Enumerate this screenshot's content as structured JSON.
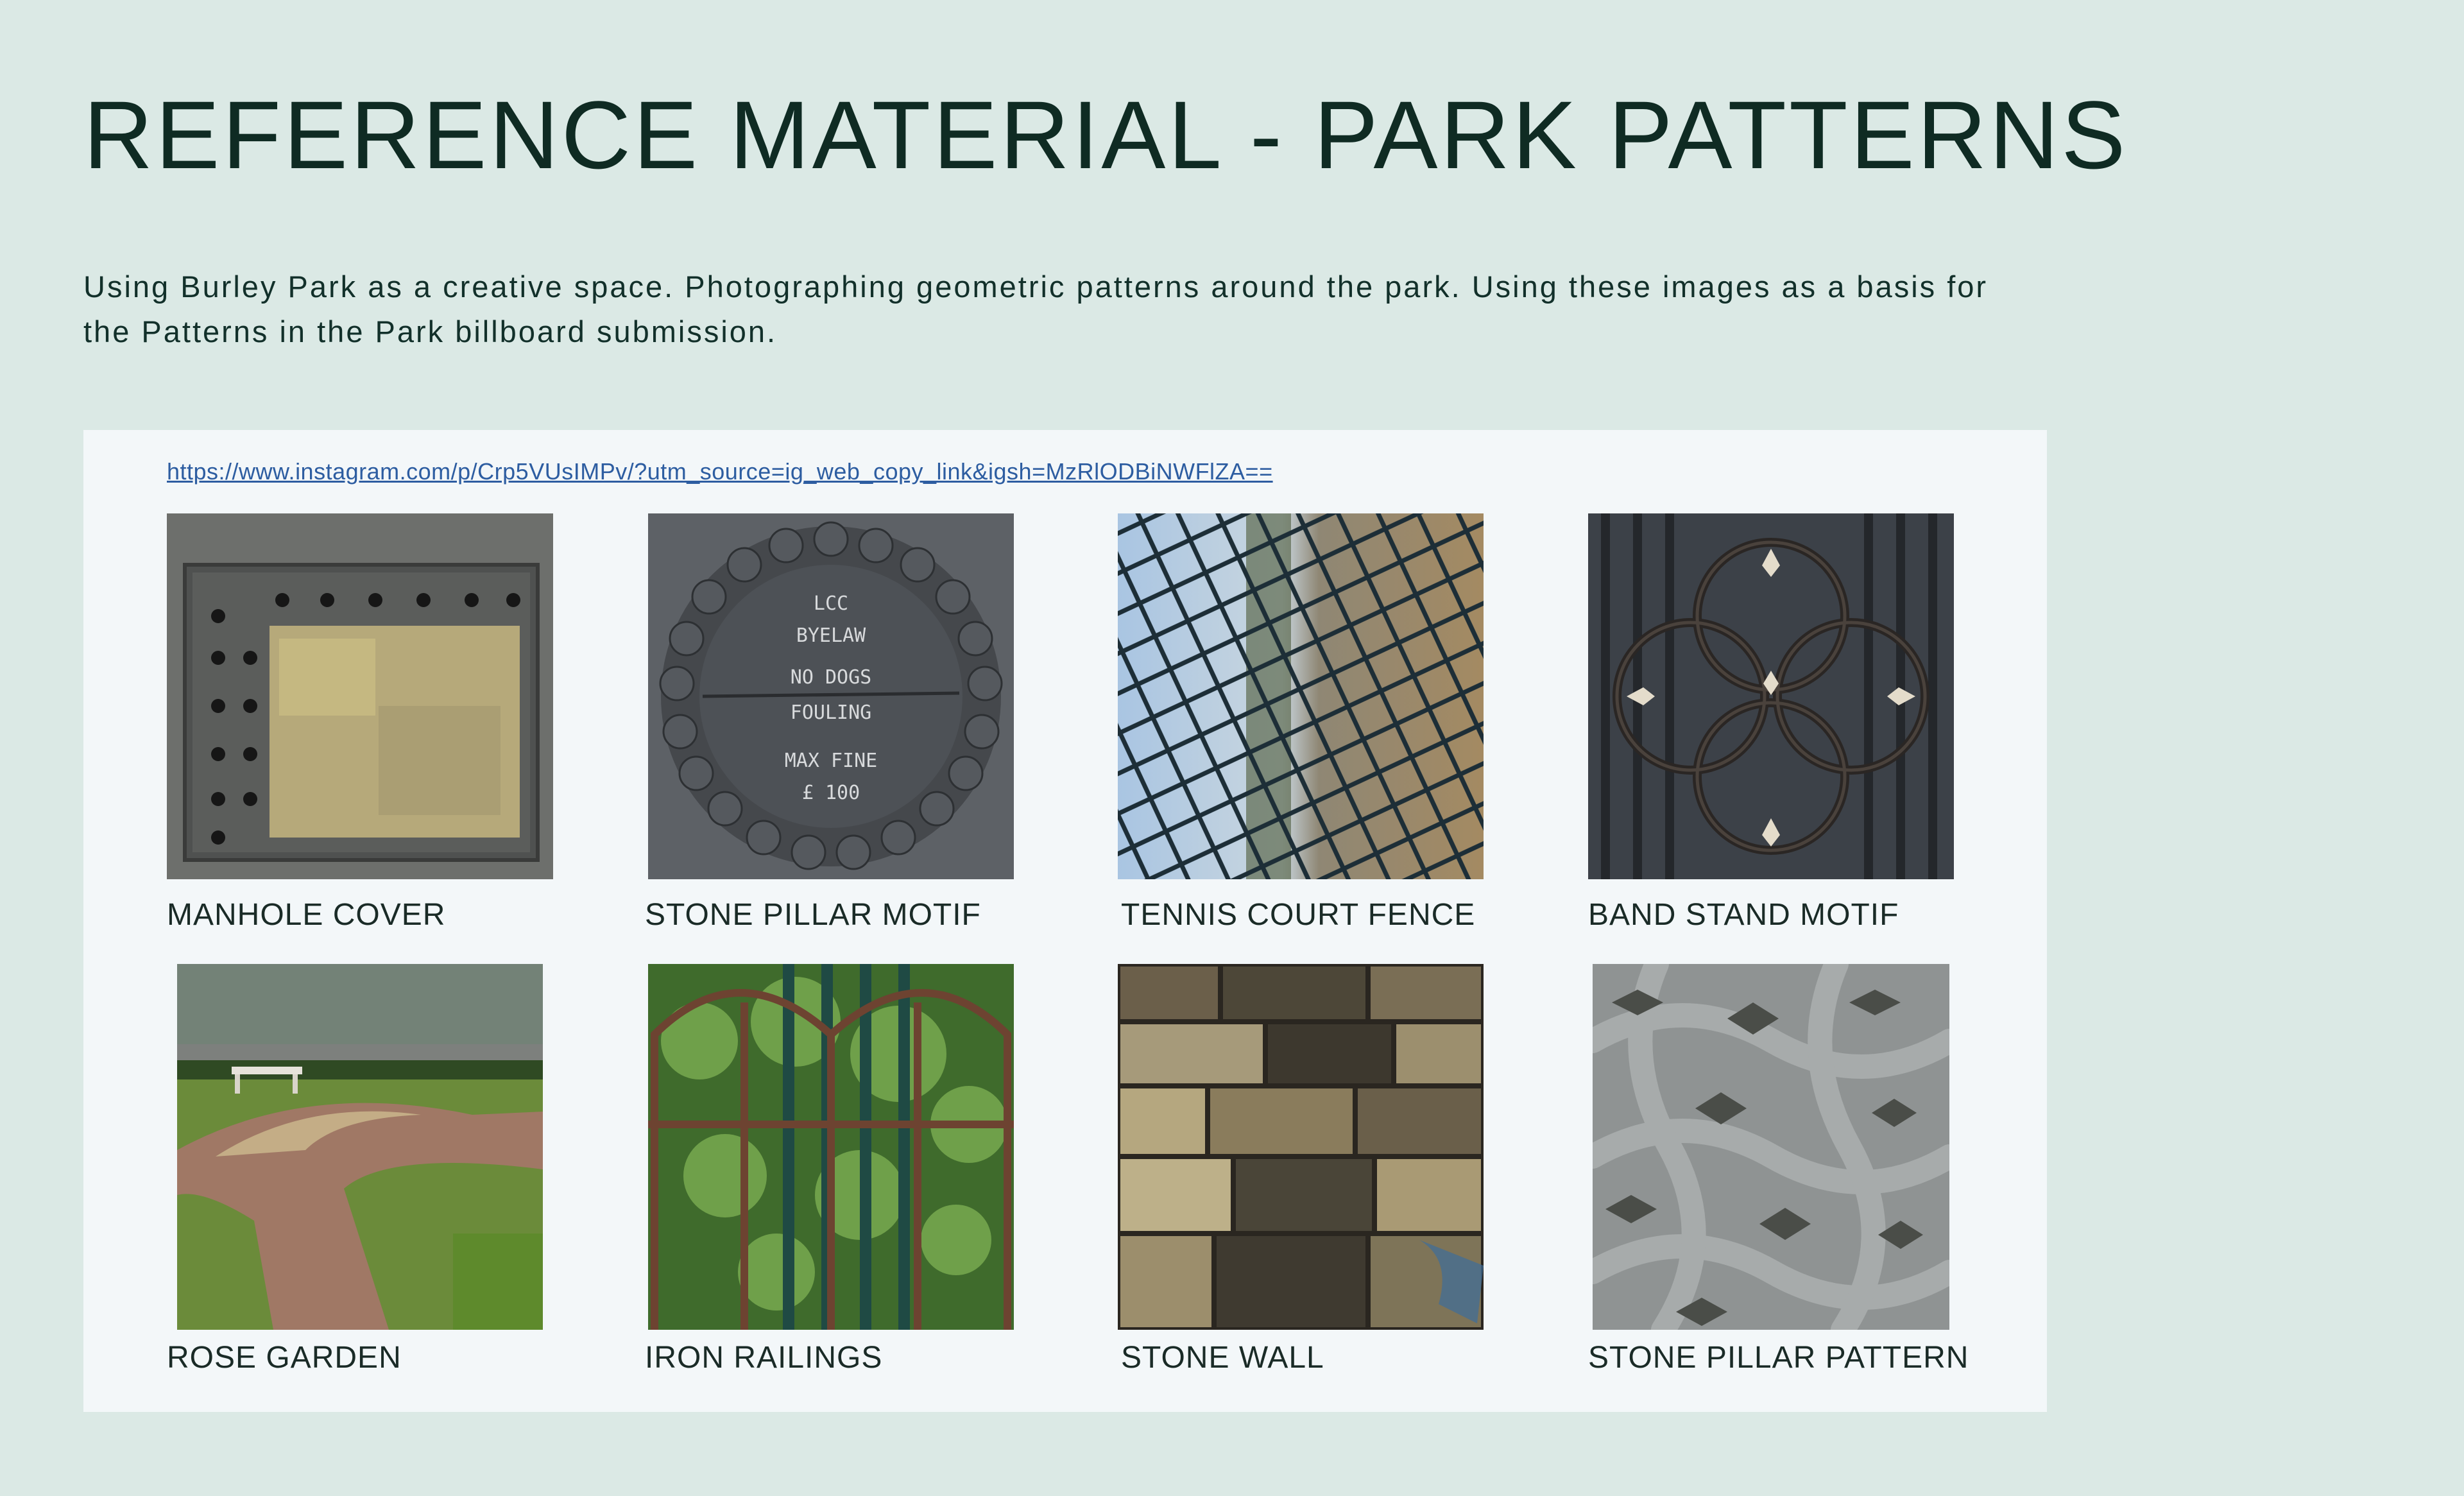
{
  "page": {
    "title": "REFERENCE MATERIAL - PARK PATTERNS",
    "description": "Using Burley Park as a creative space. Photographing geometric patterns around the park. Using these images as a basis for the Patterns in the Park billboard submission."
  },
  "panel": {
    "link": "https://www.instagram.com/p/Crp5VUsIMPv/?utm_source=ig_web_copy_link&igsh=MzRlODBiNWFlZA==",
    "photos": [
      {
        "caption": "MANHOLE COVER",
        "icon": "manhole-cover-photo"
      },
      {
        "caption": "STONE PILLAR MOTIF",
        "icon": "stone-pillar-motif-photo"
      },
      {
        "caption": "TENNIS COURT FENCE",
        "icon": "tennis-court-fence-photo"
      },
      {
        "caption": "BAND STAND MOTIF",
        "icon": "band-stand-motif-photo"
      },
      {
        "caption": "ROSE GARDEN",
        "icon": "rose-garden-photo"
      },
      {
        "caption": "IRON RAILINGS",
        "icon": "iron-railings-photo"
      },
      {
        "caption": "STONE WALL",
        "icon": "stone-wall-photo"
      },
      {
        "caption": "STONE PILLAR PATTERN",
        "icon": "stone-pillar-pattern-photo"
      }
    ],
    "pillar_text": [
      "LCC",
      "BYELAW",
      "NO DOGS",
      "FOULING",
      "MAX FINE",
      "£ 100"
    ]
  },
  "colors": {
    "background": "#dbe9e5",
    "panel": "#f3f7f9",
    "title": "#0f2b23",
    "link": "#2d5da1"
  }
}
